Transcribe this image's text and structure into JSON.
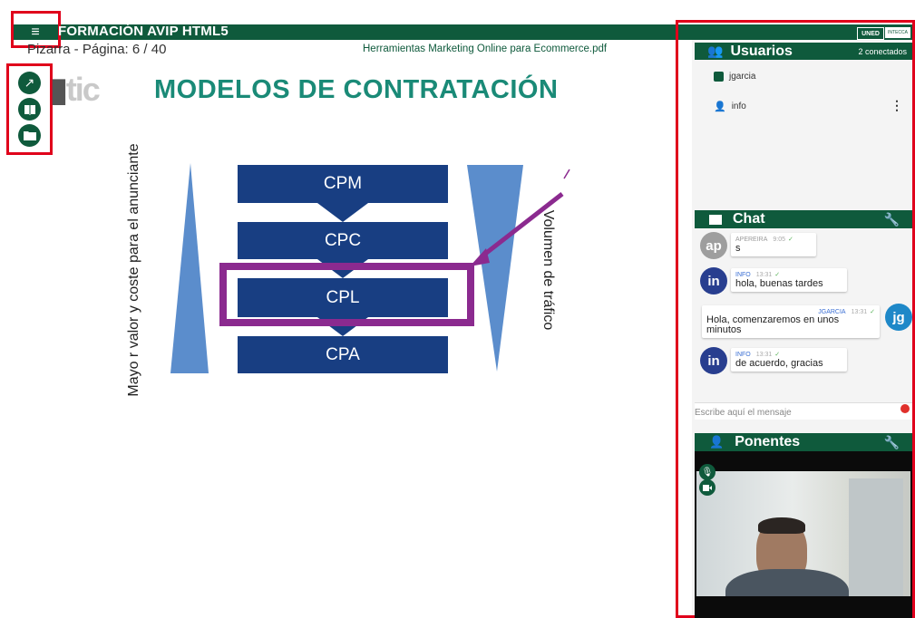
{
  "app": {
    "title": "FORMACIÓN AVIP HTML5",
    "menu_icon": "hamburger-menu-icon",
    "logos": [
      "UNED",
      "INTECCA"
    ]
  },
  "whiteboard": {
    "page_label": "Pizarra - Página: 6 / 40",
    "document_name": "Herramientas Marketing Online para Ecommerce.pdf",
    "tools": [
      {
        "name": "pointer-arrow-icon",
        "glyph": "↗"
      },
      {
        "name": "book-icon",
        "glyph": "📖"
      },
      {
        "name": "folder-icon",
        "glyph": "▬"
      }
    ]
  },
  "slide": {
    "logo_text": "tic",
    "title": "MODELOS DE CONTRATACIÓN",
    "boxes": [
      "CPM",
      "CPC",
      "CPL",
      "CPA"
    ],
    "left_label": "Mayo r valor y coste para el anunciante",
    "right_label": "Volumen de tráfico",
    "colors": {
      "box": "#183e82",
      "title": "#1a8a77",
      "highlight": "#8b2a8f",
      "triangle": "#5b8dcc"
    }
  },
  "users": {
    "title": "Usuarios",
    "count": "2 conectados",
    "list": [
      {
        "name": "jgarcia",
        "icon": "user-badge-icon"
      },
      {
        "name": "info",
        "icon": "person-icon"
      }
    ]
  },
  "chat": {
    "title": "Chat",
    "messages": [
      {
        "initials": "ap",
        "user": "APEREIRA",
        "time": "9:05",
        "text": "s",
        "color": "#9e9e9e"
      },
      {
        "initials": "in",
        "user": "INFO",
        "time": "13:31",
        "text": "hola, buenas tardes",
        "color": "#283e8f"
      },
      {
        "initials": "jg",
        "user": "JGARCIA",
        "time": "13:31",
        "text": "Hola, comenzaremos en unos minutos",
        "color": "#1e88c8"
      },
      {
        "initials": "in",
        "user": "INFO",
        "time": "13:31",
        "text": "de acuerdo, gracias",
        "color": "#283e8f"
      }
    ],
    "input_placeholder": "Escribe aquí el mensaje"
  },
  "speakers": {
    "title": "Ponentes"
  },
  "colors": {
    "brand": "#0f5a3c",
    "highlight_red": "#e0001b"
  }
}
